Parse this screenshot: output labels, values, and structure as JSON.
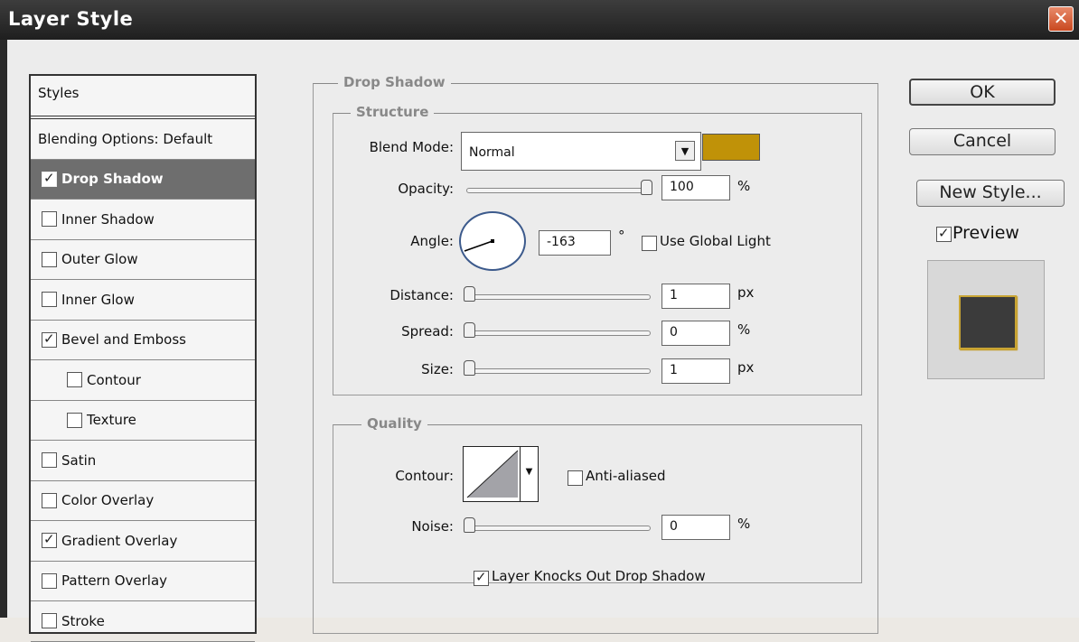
{
  "window": {
    "title": "Layer Style",
    "close_glyph": "✕"
  },
  "styles_list": {
    "header": "Styles",
    "blending": "Blending Options: Default",
    "items": [
      {
        "label": "Drop Shadow",
        "checked": true,
        "indent": false,
        "selected": true
      },
      {
        "label": "Inner Shadow",
        "checked": false,
        "indent": false,
        "selected": false
      },
      {
        "label": "Outer Glow",
        "checked": false,
        "indent": false,
        "selected": false
      },
      {
        "label": "Inner Glow",
        "checked": false,
        "indent": false,
        "selected": false
      },
      {
        "label": "Bevel and Emboss",
        "checked": true,
        "indent": false,
        "selected": false
      },
      {
        "label": "Contour",
        "checked": false,
        "indent": true,
        "selected": false
      },
      {
        "label": "Texture",
        "checked": false,
        "indent": true,
        "selected": false
      },
      {
        "label": "Satin",
        "checked": false,
        "indent": false,
        "selected": false
      },
      {
        "label": "Color Overlay",
        "checked": false,
        "indent": false,
        "selected": false
      },
      {
        "label": "Gradient Overlay",
        "checked": true,
        "indent": false,
        "selected": false
      },
      {
        "label": "Pattern Overlay",
        "checked": false,
        "indent": false,
        "selected": false
      },
      {
        "label": "Stroke",
        "checked": false,
        "indent": false,
        "selected": false
      }
    ]
  },
  "drop_shadow": {
    "section_title": "Drop Shadow",
    "structure_title": "Structure",
    "blend_mode_label": "Blend Mode:",
    "blend_mode_value": "Normal",
    "shadow_color": "#c09208",
    "opacity_label": "Opacity:",
    "opacity_value": "100",
    "opacity_unit": "%",
    "angle_label": "Angle:",
    "angle_value": "-163",
    "angle_unit": "°",
    "use_global_light_label": "Use Global Light",
    "use_global_light_checked": false,
    "distance_label": "Distance:",
    "distance_value": "1",
    "distance_unit": "px",
    "spread_label": "Spread:",
    "spread_value": "0",
    "spread_unit": "%",
    "size_label": "Size:",
    "size_value": "1",
    "size_unit": "px",
    "quality_title": "Quality",
    "contour_label": "Contour:",
    "anti_aliased_label": "Anti-aliased",
    "anti_aliased_checked": false,
    "noise_label": "Noise:",
    "noise_value": "0",
    "noise_unit": "%",
    "knockout_label": "Layer Knocks Out Drop Shadow",
    "knockout_checked": true
  },
  "buttons": {
    "ok": "OK",
    "cancel": "Cancel",
    "new_style": "New Style...",
    "preview_label": "Preview",
    "preview_checked": true
  }
}
